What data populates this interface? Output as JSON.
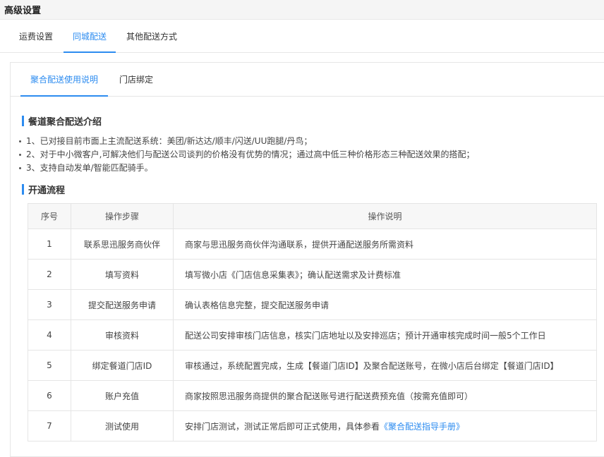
{
  "page": {
    "title": "高级设置"
  },
  "top_tabs": [
    {
      "label": "运费设置",
      "active": false
    },
    {
      "label": "同城配送",
      "active": true
    },
    {
      "label": "其他配送方式",
      "active": false
    }
  ],
  "sub_tabs": [
    {
      "label": "聚合配送使用说明",
      "active": true
    },
    {
      "label": "门店绑定",
      "active": false
    }
  ],
  "intro": {
    "title": "餐道聚合配送介绍",
    "items": [
      "1、已对接目前市面上主流配送系统：美团/新达达/顺丰/闪送/UU跑腿/丹鸟；",
      "2、对于中小微客户,可解决他们与配送公司谈判的价格没有优势的情况；通过高中低三种价格形态三种配送效果的搭配；",
      "3、支持自动发单/智能匹配骑手。"
    ]
  },
  "process": {
    "title": "开通流程",
    "columns": [
      "序号",
      "操作步骤",
      "操作说明"
    ],
    "rows": [
      {
        "no": "1",
        "step": "联系思迅服务商伙伴",
        "desc": "商家与思迅服务商伙伴沟通联系，提供开通配送服务所需资料",
        "link": ""
      },
      {
        "no": "2",
        "step": "填写资料",
        "desc": "填写微小店《门店信息采集表》；确认配送需求及计费标准",
        "link": ""
      },
      {
        "no": "3",
        "step": "提交配送服务申请",
        "desc": "确认表格信息完整，提交配送服务申请",
        "link": ""
      },
      {
        "no": "4",
        "step": "审核资料",
        "desc": "配送公司安排审核门店信息，核实门店地址以及安排巡店；预计开通审核完成时间一般5个工作日",
        "link": ""
      },
      {
        "no": "5",
        "step": "绑定餐道门店ID",
        "desc": "审核通过，系统配置完成，生成【餐道门店ID】及聚合配送账号，在微小店后台绑定【餐道门店ID】",
        "link": ""
      },
      {
        "no": "6",
        "step": "账户充值",
        "desc": "商家按照思迅服务商提供的聚合配送账号进行配送费预充值（按需充值即可）",
        "link": ""
      },
      {
        "no": "7",
        "step": "测试使用",
        "desc": "安排门店测试，测试正常后即可正式使用，具体参看",
        "link": "《聚合配送指导手册》"
      }
    ]
  },
  "colors": {
    "accent": "#2d8cf0"
  }
}
